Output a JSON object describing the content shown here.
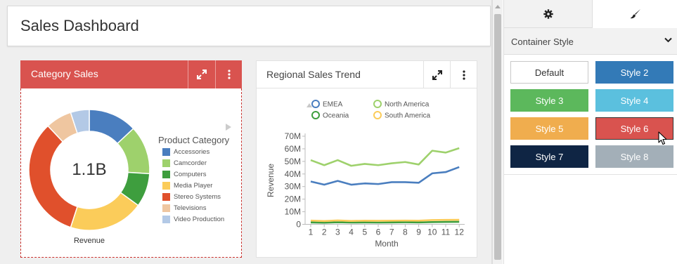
{
  "dashboard": {
    "title": "Sales Dashboard"
  },
  "card_category": {
    "title": "Category Sales",
    "center_value": "1.1B",
    "caption": "Revenue",
    "legend_title": "Product Category",
    "header_color": "#d9534f",
    "icons": [
      "expand-icon",
      "more-vertical-icon"
    ]
  },
  "card_regional": {
    "title": "Regional Sales Trend",
    "icons": [
      "expand-icon",
      "more-vertical-icon"
    ]
  },
  "chart_data": [
    {
      "type": "pie",
      "title": "Category Sales",
      "center_label": "1.1B",
      "caption": "Revenue",
      "legend_title": "Product Category",
      "slices": [
        {
          "name": "Accessories",
          "value": 0.13,
          "color": "#4a7ebf"
        },
        {
          "name": "Camcorder",
          "value": 0.13,
          "color": "#9ed16c"
        },
        {
          "name": "Computers",
          "value": 0.09,
          "color": "#3e9e3e"
        },
        {
          "name": "Media Player",
          "value": 0.2,
          "color": "#fbcc5a"
        },
        {
          "name": "Stereo Systems",
          "value": 0.33,
          "color": "#e0502c"
        },
        {
          "name": "Televisions",
          "value": 0.07,
          "color": "#efc6a0"
        },
        {
          "name": "Video Production",
          "value": 0.05,
          "color": "#b3c9e6"
        }
      ]
    },
    {
      "type": "line",
      "title": "Regional Sales Trend",
      "xlabel": "Month",
      "ylabel": "Revenue",
      "x": [
        1,
        2,
        3,
        4,
        5,
        6,
        7,
        8,
        9,
        10,
        11,
        12
      ],
      "ylim": [
        0,
        70000000
      ],
      "yticks": [
        "0",
        "10M",
        "20M",
        "30M",
        "40M",
        "50M",
        "60M",
        "70M"
      ],
      "legend_placement": "top",
      "series": [
        {
          "name": "EMEA",
          "color": "#4a7ebf",
          "values": [
            34000000,
            31500000,
            34500000,
            31500000,
            32500000,
            32000000,
            33500000,
            33500000,
            33000000,
            40500000,
            41500000,
            45500000
          ]
        },
        {
          "name": "North America",
          "color": "#9ed16c",
          "values": [
            51000000,
            47000000,
            51000000,
            46500000,
            48000000,
            47000000,
            48500000,
            49500000,
            47500000,
            58500000,
            57000000,
            60500000
          ]
        },
        {
          "name": "Oceania",
          "color": "#3e9e3e",
          "values": [
            1500000,
            1300000,
            1600000,
            1400000,
            1500000,
            1400000,
            1500000,
            1600000,
            1500000,
            1800000,
            1900000,
            2000000
          ]
        },
        {
          "name": "South America",
          "color": "#fbcc5a",
          "values": [
            3000000,
            2600000,
            3100000,
            2700000,
            2900000,
            2800000,
            2900000,
            3000000,
            2900000,
            3400000,
            3500000,
            3600000
          ]
        }
      ]
    }
  ],
  "panel": {
    "tabs": [
      {
        "name": "settings",
        "icon": "gear-icon"
      },
      {
        "name": "style",
        "icon": "paintbrush-icon"
      }
    ],
    "section_label": "Container Style",
    "styles": [
      {
        "label": "Default",
        "bg": "#ffffff",
        "fg": "#333333"
      },
      {
        "label": "Style 2",
        "bg": "#337ab7",
        "fg": "#ffffff"
      },
      {
        "label": "Style 3",
        "bg": "#5cb85c",
        "fg": "#ffffff"
      },
      {
        "label": "Style 4",
        "bg": "#5bc0de",
        "fg": "#ffffff"
      },
      {
        "label": "Style 5",
        "bg": "#f0ad4e",
        "fg": "#ffffff"
      },
      {
        "label": "Style 6",
        "bg": "#d9534f",
        "fg": "#ffffff",
        "selected": true
      },
      {
        "label": "Style 7",
        "bg": "#0f2544",
        "fg": "#ffffff"
      },
      {
        "label": "Style 8",
        "bg": "#a3afb8",
        "fg": "#ffffff"
      }
    ]
  }
}
